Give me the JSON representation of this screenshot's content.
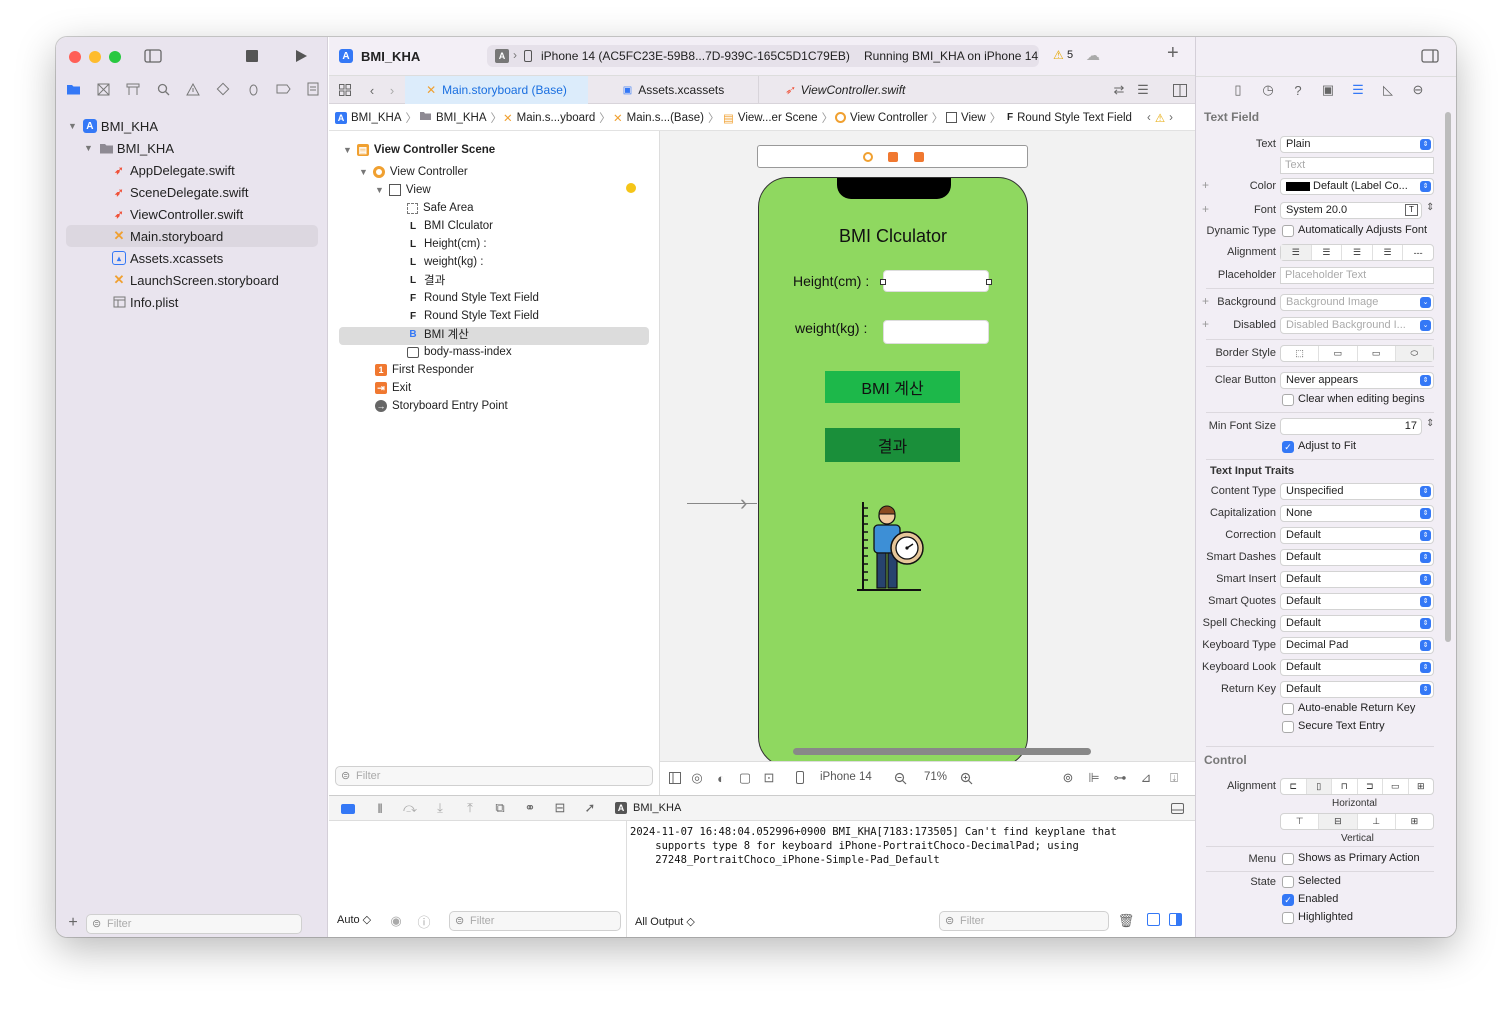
{
  "toolbar": {
    "project_name": "BMI_KHA",
    "run_destination": "iPhone 14 (AC5FC23E-59B8...7D-939C-165C5D1C79EB)",
    "status": "Running BMI_KHA on iPhone 14",
    "warning_count": "5"
  },
  "tabs": [
    {
      "label": "Main.storyboard (Base)"
    },
    {
      "label": "Assets.xcassets"
    },
    {
      "label": "ViewController.swift"
    }
  ],
  "navigator": {
    "items": [
      {
        "label": "BMI_KHA"
      },
      {
        "label": "BMI_KHA"
      },
      {
        "label": "AppDelegate.swift"
      },
      {
        "label": "SceneDelegate.swift"
      },
      {
        "label": "ViewController.swift"
      },
      {
        "label": "Main.storyboard"
      },
      {
        "label": "Assets.xcassets"
      },
      {
        "label": "LaunchScreen.storyboard"
      },
      {
        "label": "Info.plist"
      }
    ],
    "filter_placeholder": "Filter"
  },
  "jumpbar": [
    "BMI_KHA",
    "BMI_KHA",
    "Main.s...yboard",
    "Main.s...(Base)",
    "View...er Scene",
    "View Controller",
    "View",
    "Round Style Text Field"
  ],
  "outline": {
    "items": [
      {
        "label": "View Controller Scene"
      },
      {
        "label": "View Controller"
      },
      {
        "label": "View"
      },
      {
        "label": "Safe Area"
      },
      {
        "label": "BMI Clculator"
      },
      {
        "label": "Height(cm) :"
      },
      {
        "label": "weight(kg) :"
      },
      {
        "label": "결과"
      },
      {
        "label": "Round Style Text Field"
      },
      {
        "label": "Round Style Text Field"
      },
      {
        "label": "BMI 계산"
      },
      {
        "label": "body-mass-index"
      },
      {
        "label": "First Responder"
      },
      {
        "label": "Exit"
      },
      {
        "label": "Storyboard Entry Point"
      }
    ],
    "filter_placeholder": "Filter"
  },
  "phone": {
    "title": "BMI Clculator",
    "height_label": "Height(cm) :",
    "weight_label": "weight(kg) :",
    "calc_button": "BMI 계산",
    "result_button": "결과",
    "bg_color": "#8fd860",
    "button_color": "#1db84a",
    "result_color": "#1a8f3a"
  },
  "canvas_bar": {
    "device": "iPhone 14",
    "zoom": "71%"
  },
  "debug": {
    "target": "BMI_KHA",
    "auto_label": "Auto ◇",
    "filter_placeholder": "Filter",
    "output_label": "All Output ◇",
    "console_text": "2024-11-07 16:48:04.052996+0900 BMI_KHA[7183:173505] Can't find keyplane that\n    supports type 8 for keyboard iPhone-PortraitChoco-DecimalPad; using\n    27248_PortraitChoco_iPhone-Simple-Pad_Default"
  },
  "inspector": {
    "section_title": "Text Field",
    "text_label": "Text",
    "text_value": "Plain",
    "text_placeholder": "Text",
    "color_label": "Color",
    "color_value": "Default (Label Co...",
    "font_label": "Font",
    "font_value": "System 20.0",
    "dynamic_label": "Dynamic Type",
    "dynamic_value": "Automatically Adjusts Font",
    "alignment_label": "Alignment",
    "placeholder_label": "Placeholder",
    "placeholder_value": "Placeholder Text",
    "background_label": "Background",
    "background_value": "Background Image",
    "disabled_label": "Disabled",
    "disabled_value": "Disabled Background I...",
    "border_label": "Border Style",
    "clear_label": "Clear Button",
    "clear_value": "Never appears",
    "clear_editing": "Clear when editing begins",
    "min_font_label": "Min Font Size",
    "min_font_value": "17",
    "adjust_fit": "Adjust to Fit",
    "traits_title": "Text Input Traits",
    "traits": [
      {
        "label": "Content Type",
        "value": "Unspecified"
      },
      {
        "label": "Capitalization",
        "value": "None"
      },
      {
        "label": "Correction",
        "value": "Default"
      },
      {
        "label": "Smart Dashes",
        "value": "Default"
      },
      {
        "label": "Smart Insert",
        "value": "Default"
      },
      {
        "label": "Smart Quotes",
        "value": "Default"
      },
      {
        "label": "Spell Checking",
        "value": "Default"
      },
      {
        "label": "Keyboard Type",
        "value": "Decimal Pad"
      },
      {
        "label": "Keyboard Look",
        "value": "Default"
      },
      {
        "label": "Return Key",
        "value": "Default"
      }
    ],
    "auto_return": "Auto-enable Return Key",
    "secure": "Secure Text Entry",
    "control_title": "Control",
    "control_alignment_label": "Alignment",
    "horizontal": "Horizontal",
    "vertical": "Vertical",
    "menu_label": "Menu",
    "menu_value": "Shows as Primary Action",
    "state_label": "State",
    "state_selected": "Selected",
    "state_enabled": "Enabled",
    "state_highlighted": "Highlighted"
  },
  "colors": {
    "accent": "#3478f6",
    "selection": "#dcd7e0"
  }
}
